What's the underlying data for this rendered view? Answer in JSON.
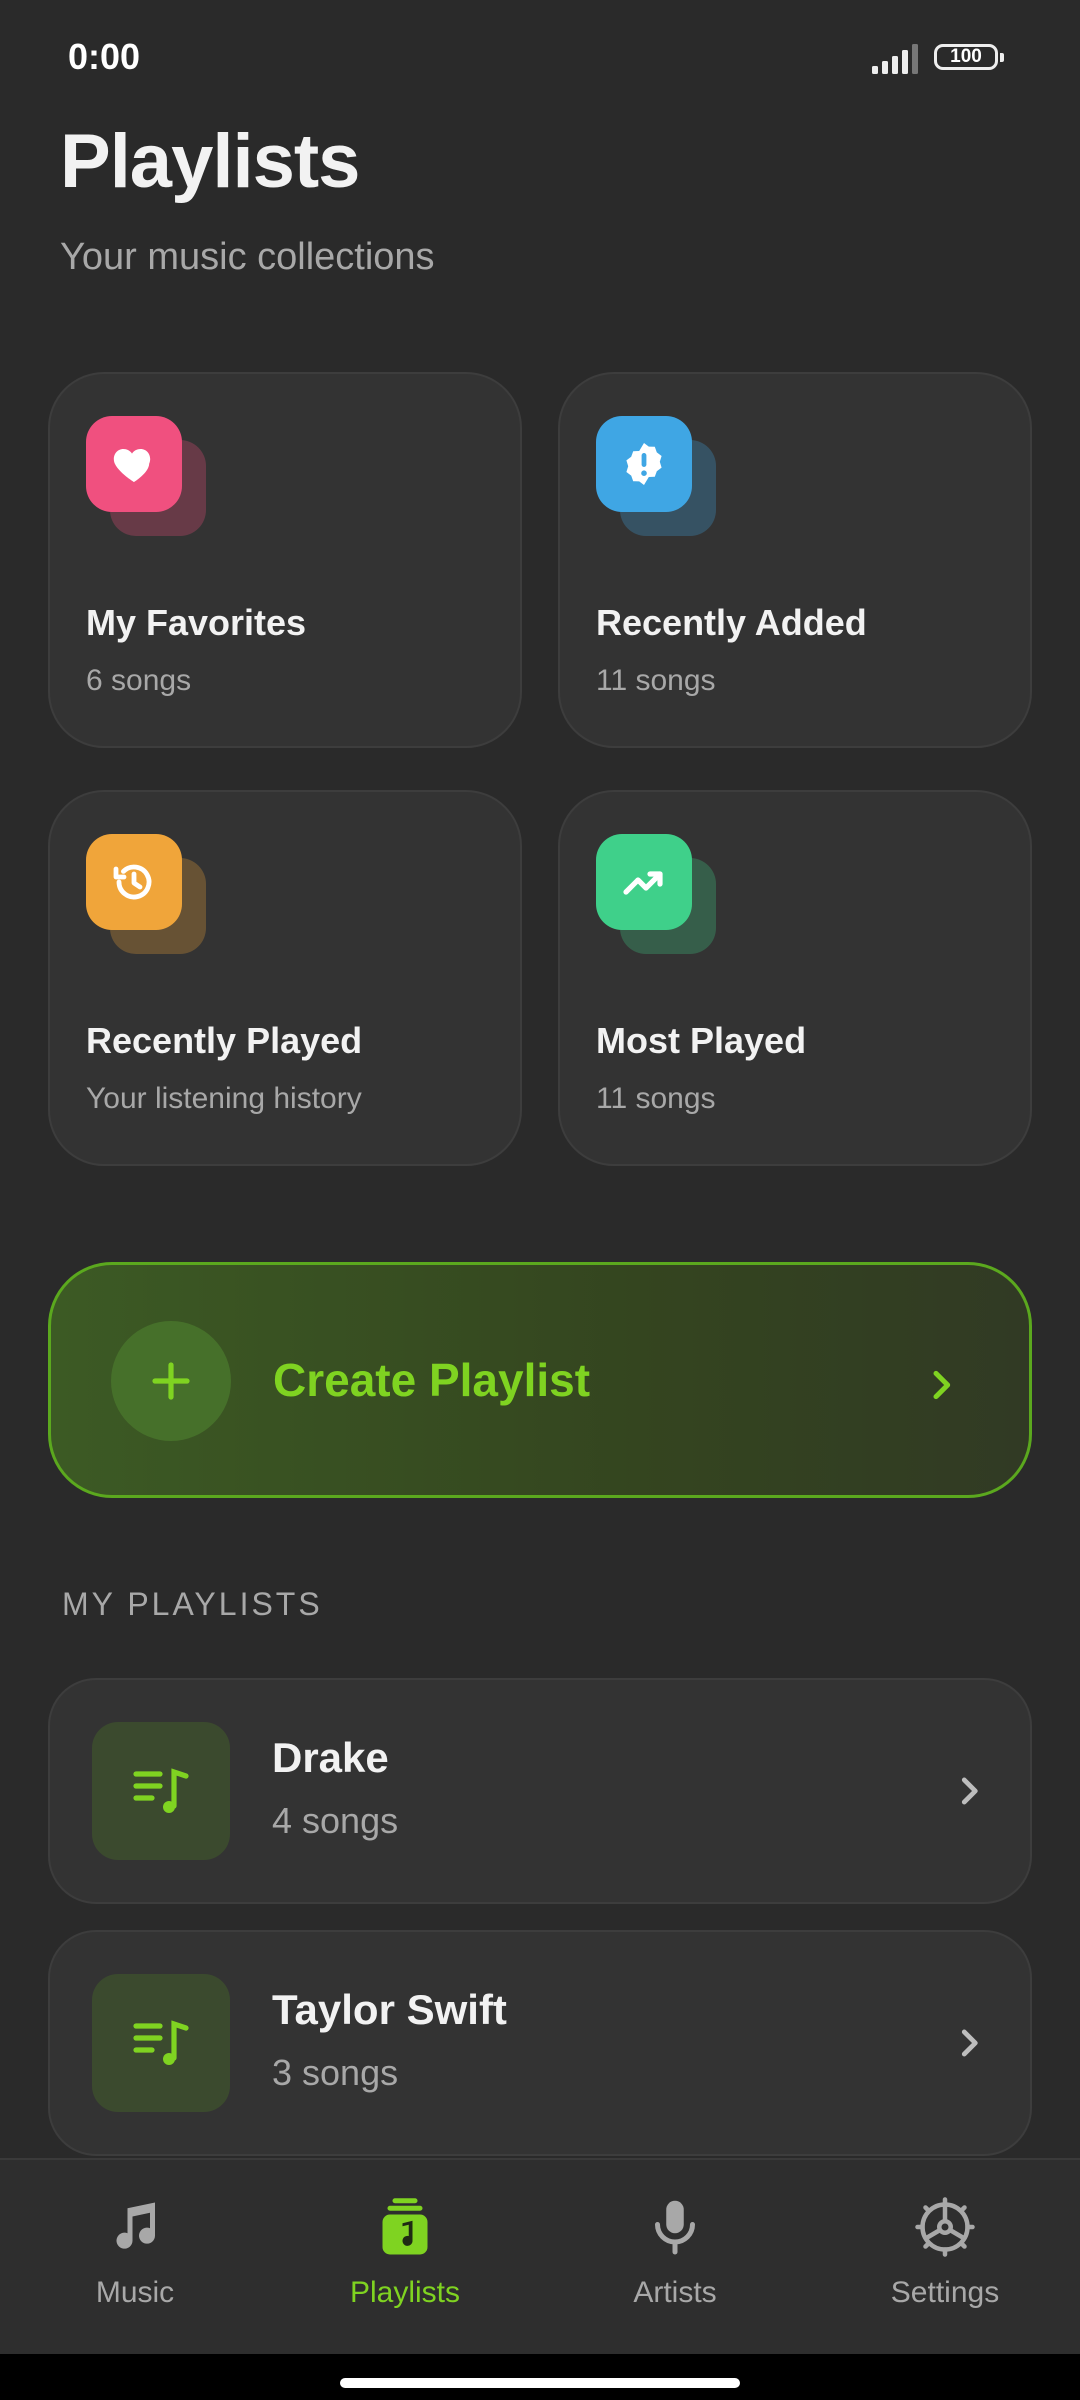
{
  "status_bar": {
    "time": "0:00",
    "battery": "100"
  },
  "header": {
    "title": "Playlists",
    "subtitle": "Your music collections"
  },
  "colors": {
    "accent": "#7fd321",
    "favorites": "#f0507f",
    "recently_added": "#3fa6e4",
    "recently_played": "#f0a53a",
    "most_played": "#3fd08a"
  },
  "quick_cards": [
    {
      "title": "My Favorites",
      "subtitle": "6 songs",
      "icon": "heart-icon"
    },
    {
      "title": "Recently Added",
      "subtitle": "11 songs",
      "icon": "new-badge-icon"
    },
    {
      "title": "Recently Played",
      "subtitle": "Your listening history",
      "icon": "history-icon"
    },
    {
      "title": "Most Played",
      "subtitle": "11 songs",
      "icon": "trending-up-icon"
    }
  ],
  "create_playlist": {
    "label": "Create Playlist",
    "icon": "plus-icon"
  },
  "my_playlists": {
    "section_label": "MY PLAYLISTS",
    "items": [
      {
        "title": "Drake",
        "subtitle": "4 songs",
        "icon": "playlist-music-icon"
      },
      {
        "title": "Taylor Swift",
        "subtitle": "3 songs",
        "icon": "playlist-music-icon"
      }
    ]
  },
  "bottom_nav": {
    "items": [
      {
        "label": "Music",
        "icon": "music-note-icon",
        "active": false
      },
      {
        "label": "Playlists",
        "icon": "playlists-icon",
        "active": true
      },
      {
        "label": "Artists",
        "icon": "microphone-icon",
        "active": false
      },
      {
        "label": "Settings",
        "icon": "settings-gear-icon",
        "active": false
      }
    ]
  }
}
